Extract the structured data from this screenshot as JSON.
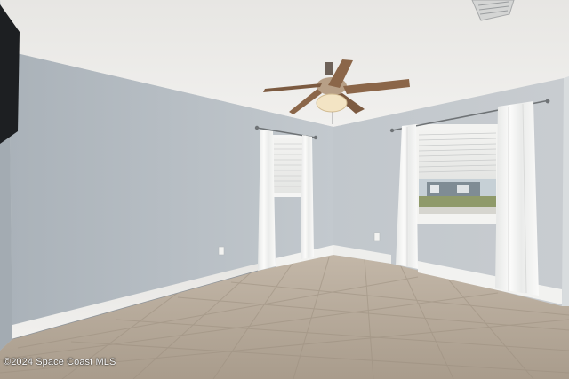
{
  "photo": {
    "watermark": "©2024 Space Coast MLS",
    "colors": {
      "wall_left": "#bcc3c9",
      "wall_right": "#c3c9ce",
      "ceiling": "#ecebe8",
      "floor": "#b5a898",
      "baseboard": "#f4f4f2",
      "curtain": "#f6f6f4"
    }
  }
}
